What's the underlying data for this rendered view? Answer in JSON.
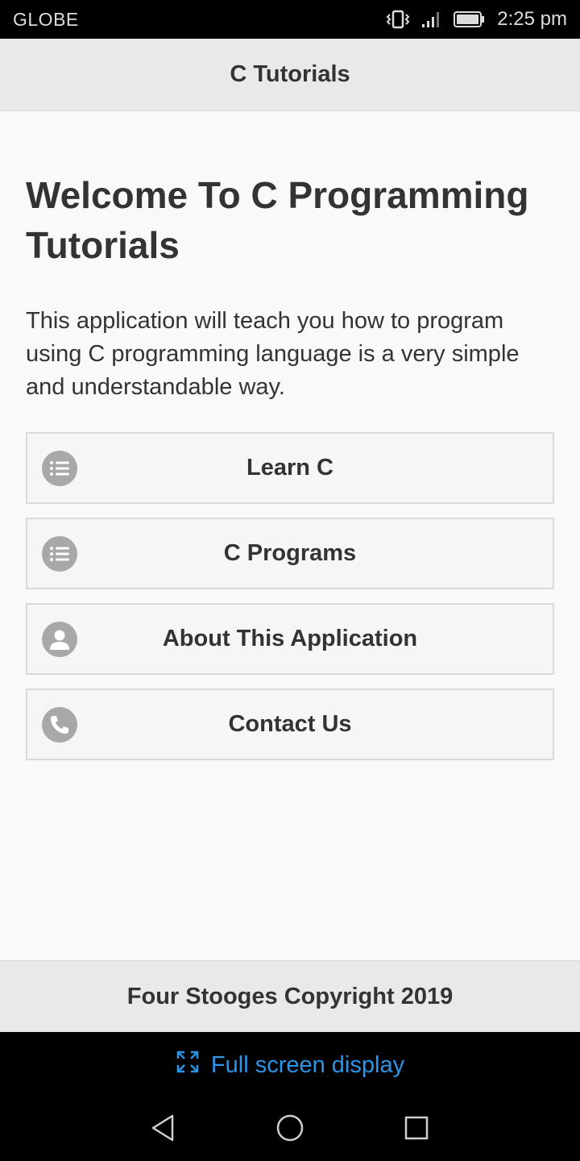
{
  "status_bar": {
    "carrier": "GLOBE",
    "time": "2:25 pm",
    "icons": [
      "vibrate-icon",
      "signal-icon",
      "battery-icon"
    ]
  },
  "header": {
    "title": "C Tutorials"
  },
  "main": {
    "welcome_title": "Welcome To C Programming Tutorials",
    "intro_text": "This application will teach you how to program using C programming language is a very simple and understandable way.",
    "menu": [
      {
        "label": "Learn C",
        "icon": "list-icon"
      },
      {
        "label": "C Programs",
        "icon": "list-icon"
      },
      {
        "label": "About This Application",
        "icon": "user-icon"
      },
      {
        "label": "Contact Us",
        "icon": "phone-icon"
      }
    ]
  },
  "footer": {
    "text": "Four Stooges Copyright 2019"
  },
  "system": {
    "fullscreen_label": "Full screen display",
    "nav": [
      "back-icon",
      "home-icon",
      "recents-icon"
    ]
  },
  "colors": {
    "accent_link": "#2b95e9",
    "icon_circle": "#a8a8a8",
    "text": "#333333"
  }
}
